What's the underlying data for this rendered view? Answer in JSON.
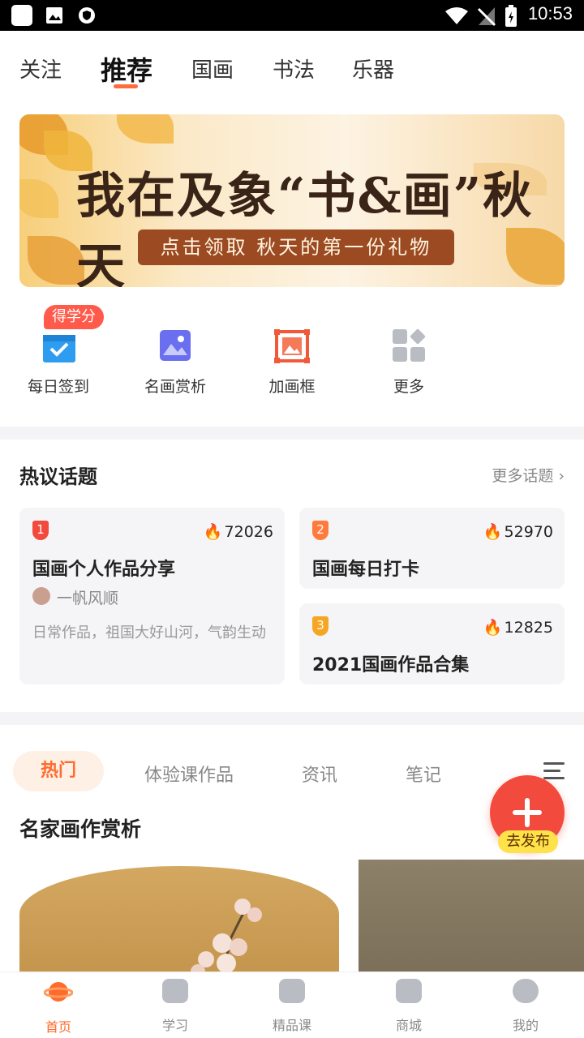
{
  "status_bar": {
    "time": "10:53"
  },
  "top_tabs": [
    "关注",
    "推荐",
    "国画",
    "书法",
    "乐器"
  ],
  "banner": {
    "title": "我在及象“书&画”秋天",
    "subtitle": "点击领取 秋天的第一份礼物"
  },
  "quick_actions": [
    {
      "label": "每日签到",
      "icon": "calendar-check-icon",
      "badge": "得学分"
    },
    {
      "label": "名画赏析",
      "icon": "picture-icon"
    },
    {
      "label": "加画框",
      "icon": "frame-icon"
    },
    {
      "label": "更多",
      "icon": "grid-more-icon"
    }
  ],
  "hot_topics": {
    "title": "热议话题",
    "more": "更多话题",
    "cards": [
      {
        "rank": "1",
        "heat": "72026",
        "title": "国画个人作品分享",
        "author": "一帆风顺",
        "desc": "日常作品，祖国大好山河，气韵生动"
      },
      {
        "rank": "2",
        "heat": "52970",
        "title": "国画每日打卡"
      },
      {
        "rank": "3",
        "heat": "12825",
        "title": "2021国画作品合集"
      }
    ]
  },
  "feed_tabs": [
    "热门",
    "体验课作品",
    "资讯",
    "笔记"
  ],
  "section_title": "名家画作赏析",
  "fab": {
    "label": "去发布"
  },
  "bottom_nav": [
    "首页",
    "学习",
    "精品课",
    "商城",
    "我的"
  ],
  "colors": {
    "accent": "#ff6b2c",
    "rank1": "#f24a3c",
    "rank2": "#ff7a3c",
    "rank3": "#f5a623"
  }
}
